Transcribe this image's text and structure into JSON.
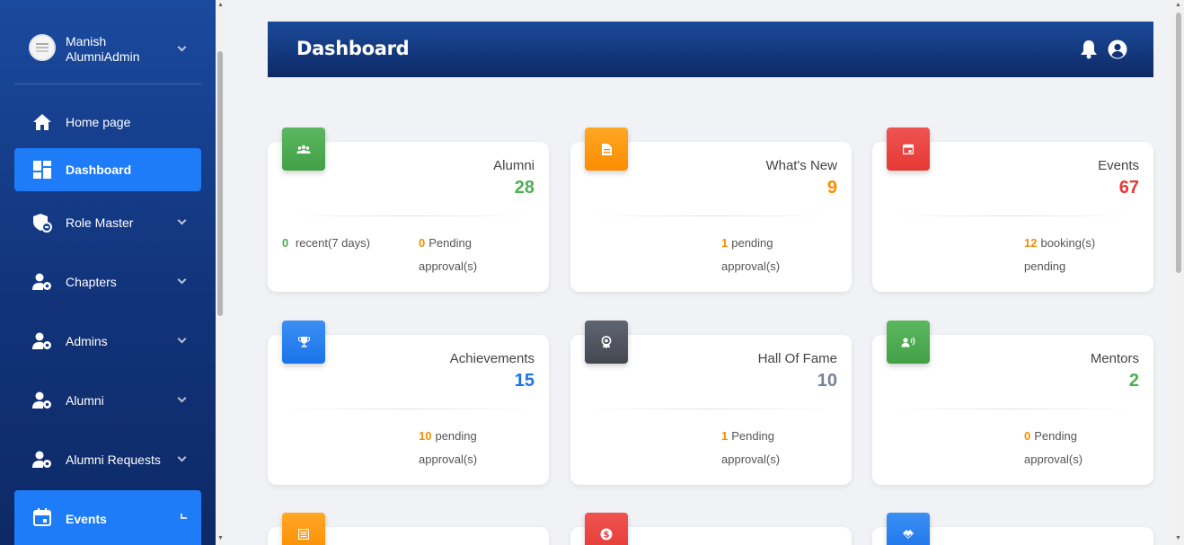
{
  "sidebar": {
    "user_first": "Manish",
    "user_second": "AlumniAdmin",
    "items": [
      {
        "label": "Home page"
      },
      {
        "label": "Dashboard"
      },
      {
        "label": "Role Master"
      },
      {
        "label": "Chapters"
      },
      {
        "label": "Admins"
      },
      {
        "label": "Alumni"
      },
      {
        "label": "Alumni Requests"
      },
      {
        "label": "Events"
      }
    ]
  },
  "header": {
    "title": "Dashboard"
  },
  "cards": [
    {
      "title": "Alumni",
      "value": "28",
      "stat1_num": "0",
      "stat1_line1": "recent(7 days)",
      "stat2_num": "0",
      "stat2_line1": "Pending",
      "stat2_line2": "approval(s)"
    },
    {
      "title": "What's New",
      "value": "9",
      "stat_num": "1",
      "stat_line1": "pending",
      "stat_line2": "approval(s)"
    },
    {
      "title": "Events",
      "value": "67",
      "stat_num": "12",
      "stat_line1": "booking(s)",
      "stat_line2": "pending"
    },
    {
      "title": "Achievements",
      "value": "15",
      "stat_num": "10",
      "stat_line1": "pending",
      "stat_line2": "approval(s)"
    },
    {
      "title": "Hall Of Fame",
      "value": "10",
      "stat_num": "1",
      "stat_line1": "Pending",
      "stat_line2": "approval(s)"
    },
    {
      "title": "Mentors",
      "value": "2",
      "stat_num": "0",
      "stat_line1": "Pending",
      "stat_line2": "approval(s)"
    }
  ],
  "colors": {
    "green": "#4caf50",
    "orange": "#fb8c00",
    "red": "#e53935",
    "blue": "#1a73e8",
    "gray": "#7b809a",
    "active_nav": "#1e7cf9"
  }
}
